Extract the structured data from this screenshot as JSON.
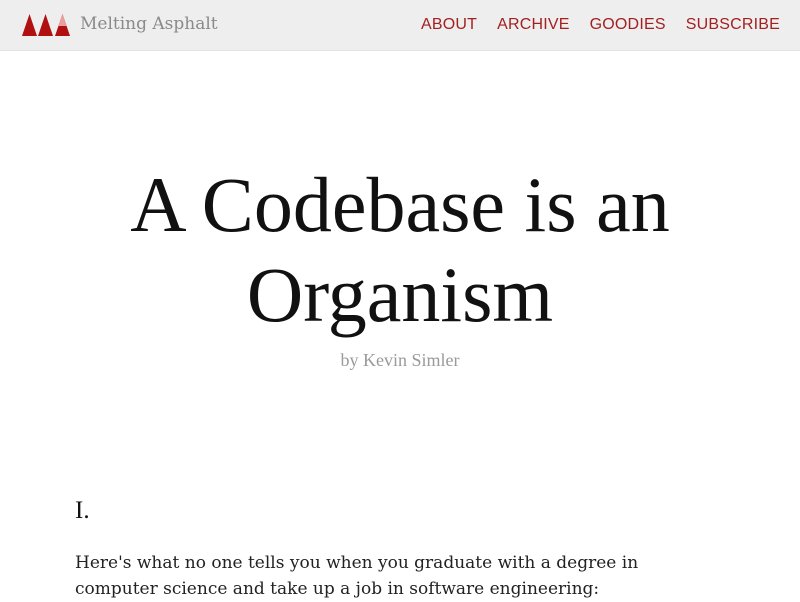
{
  "site": {
    "name": "Melting Asphalt",
    "logo_icon": "triangles-logo-icon",
    "logo_colors": [
      "#b01010",
      "#b01010",
      "#e8a0a0"
    ]
  },
  "nav": {
    "links": [
      "ABOUT",
      "ARCHIVE",
      "GOODIES",
      "SUBSCRIBE"
    ],
    "link_color": "#a32020"
  },
  "post": {
    "title": "A Codebase is an Organism",
    "byline": "by Kevin Simler",
    "section": "I.",
    "intro": "Here's what no one tells you when you graduate with a degree in computer science and take up a job in software engineering:"
  }
}
